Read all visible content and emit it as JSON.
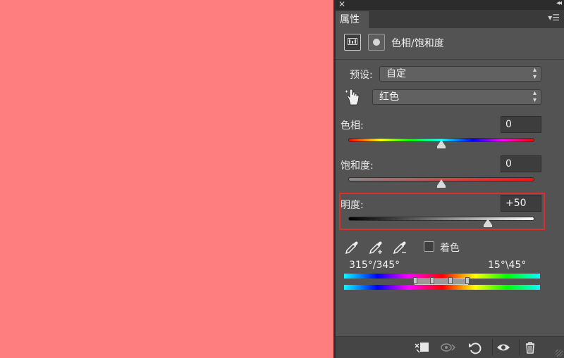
{
  "canvas": {
    "fill_color": "#fe7d7f"
  },
  "panel": {
    "tab_label": "属性",
    "close_icon": "close-icon",
    "collapse_icon": "double-chevron-icon",
    "menu_icon": "panel-menu-icon"
  },
  "adjustment": {
    "title": "色相/饱和度",
    "icons": [
      "hue-saturation-adjustment-icon",
      "layer-mask-icon"
    ]
  },
  "preset": {
    "label": "预设:",
    "value": "自定"
  },
  "channel": {
    "value": "红色",
    "hand_icon": "targeted-adjustment-hand-icon"
  },
  "hue": {
    "label": "色相:",
    "value": "0",
    "slider_position": 0.5
  },
  "saturation": {
    "label": "饱和度:",
    "value": "0",
    "slider_position": 0.5
  },
  "lightness": {
    "label": "明度:",
    "value": "+50",
    "slider_position": 0.75
  },
  "tools": {
    "icons": [
      "eyedropper-icon",
      "eyedropper-plus-icon",
      "eyedropper-minus-icon"
    ],
    "colorize_label": "着色",
    "colorize_checked": false
  },
  "color_range": {
    "left": "315°/345°",
    "right": "15°\\45°"
  },
  "bottom_icons": [
    "clip-to-layer-icon",
    "view-previous-state-icon",
    "reset-icon",
    "visibility-eye-icon",
    "trash-icon"
  ],
  "colors": {
    "highlight": "#d7312e",
    "panel_bg": "#535353"
  }
}
